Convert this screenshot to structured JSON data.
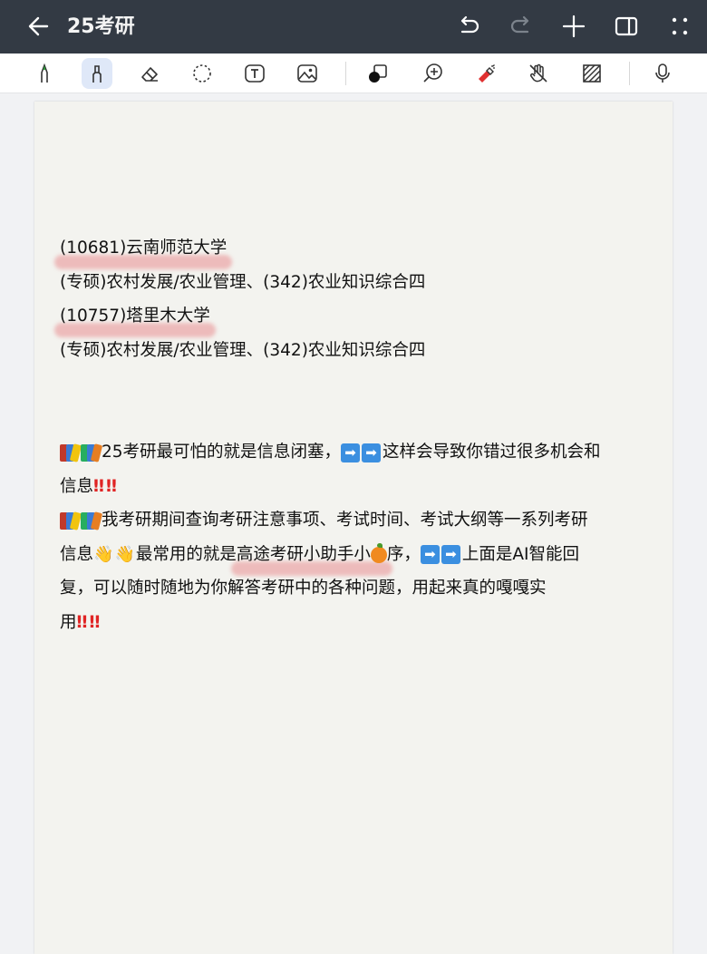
{
  "app": {
    "title": "25考研"
  },
  "toolbar": {
    "tools": [
      "pen-icon",
      "highlighter-icon",
      "eraser-icon",
      "lasso-icon",
      "text-icon",
      "image-icon",
      "shape-icon",
      "zoom-icon",
      "laser-pointer-icon",
      "hand-icon",
      "pattern-icon",
      "microphone-icon"
    ],
    "active_tool": "highlighter-icon"
  },
  "note": {
    "lines": {
      "l1": "(10681)云南师范大学",
      "l2": "(专硕)农村发展/农业管理、(342)农业知识综合四",
      "l3": "(10757)塔里木大学",
      "l4": "(专硕)农村发展/农业管理、(342)农业知识综合四",
      "p1a": "25考研最可怕的就是信息闭塞，",
      "p1b": "这样会导致你错过很多机会和",
      "p1c": "信息",
      "p2a": "我考研期间查询考研注意事项、考试时间、考试大纲等一系列考研",
      "p2b": "信息",
      "p2c": "最常用的就是",
      "p2d": "高途考研小助手小",
      "p2e": "序，",
      "p2f": "上面是AI智能回",
      "p2g": "复，可以随时随地为你解答考研中的各种问题，用起来真的嘎嘎实",
      "p2h": "用"
    },
    "emoji": {
      "book": "books-emoji",
      "arrow": "➡",
      "bang": "‼",
      "hand": "👋",
      "orange": "orange-emoji"
    },
    "highlight_color": "#e6787d"
  }
}
